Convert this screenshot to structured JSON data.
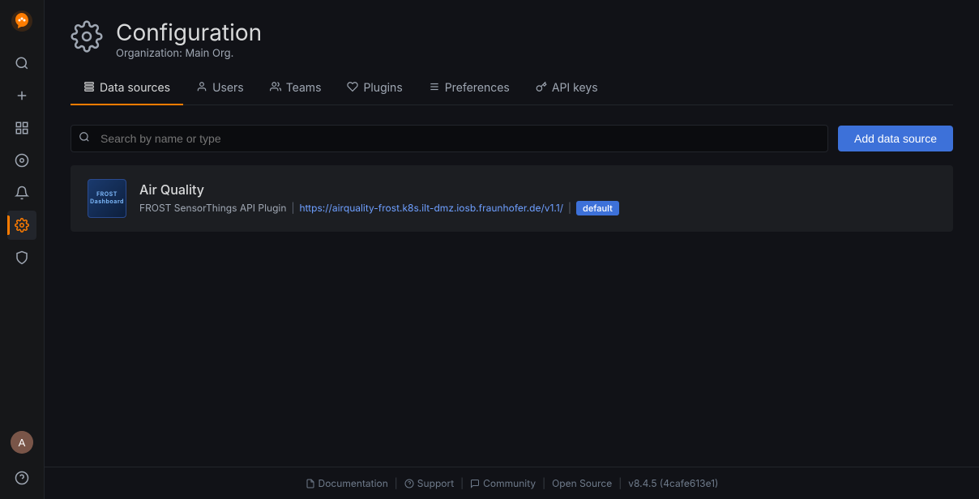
{
  "app": {
    "logo_label": "Grafana",
    "version": "v8.4.5 (4cafe613e1)"
  },
  "sidebar": {
    "items": [
      {
        "id": "search",
        "icon": "🔍",
        "label": "Search",
        "active": false
      },
      {
        "id": "new",
        "icon": "+",
        "label": "Create",
        "active": false
      },
      {
        "id": "dashboards",
        "icon": "⊞",
        "label": "Dashboards",
        "active": false
      },
      {
        "id": "explore",
        "icon": "◎",
        "label": "Explore",
        "active": false
      },
      {
        "id": "alerting",
        "icon": "🔔",
        "label": "Alerting",
        "active": false
      },
      {
        "id": "configuration",
        "icon": "⚙",
        "label": "Configuration",
        "active": true
      },
      {
        "id": "shield",
        "icon": "🛡",
        "label": "Server Admin",
        "active": false
      }
    ],
    "bottom_items": [
      {
        "id": "help",
        "icon": "?",
        "label": "Help",
        "active": false
      }
    ]
  },
  "page": {
    "title": "Configuration",
    "subtitle": "Organization: Main Org.",
    "icon": "⚙"
  },
  "tabs": [
    {
      "id": "datasources",
      "label": "Data sources",
      "icon": "⊟",
      "active": true
    },
    {
      "id": "users",
      "label": "Users",
      "icon": "👤",
      "active": false
    },
    {
      "id": "teams",
      "label": "Teams",
      "icon": "👥",
      "active": false
    },
    {
      "id": "plugins",
      "label": "Plugins",
      "icon": "🔌",
      "active": false
    },
    {
      "id": "preferences",
      "label": "Preferences",
      "icon": "⚙",
      "active": false
    },
    {
      "id": "apikeys",
      "label": "API keys",
      "icon": "🔑",
      "active": false
    }
  ],
  "toolbar": {
    "search_placeholder": "Search by name or type",
    "add_button_label": "Add data source"
  },
  "datasources": [
    {
      "id": "air-quality",
      "name": "Air Quality",
      "plugin": "FROST SensorThings API Plugin",
      "url": "https://airquality-frost.k8s.ilt-dmz.iosb.fraunhofer.de/v1.1/",
      "badge": "default",
      "logo_text": "FROST\nDashboard"
    }
  ],
  "footer": {
    "documentation_label": "Documentation",
    "support_label": "Support",
    "community_label": "Community",
    "opensource_label": "Open Source",
    "version": "v8.4.5 (4cafe613e1)"
  }
}
